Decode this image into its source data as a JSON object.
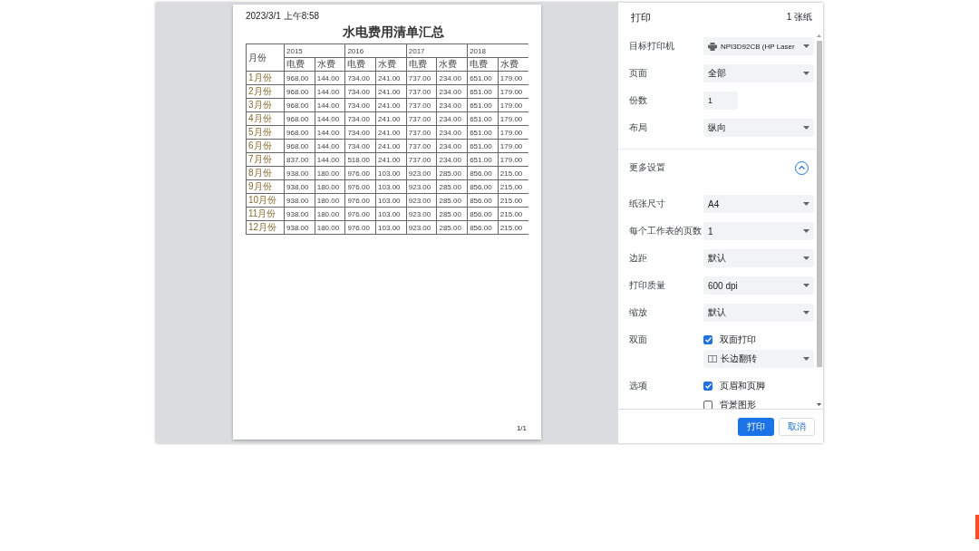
{
  "preview": {
    "timestamp": "2023/3/1 上午8:58",
    "title": "水电费用清单汇总",
    "table": {
      "corner": "月份",
      "years": [
        "2015",
        "2016",
        "2017",
        "2018"
      ],
      "subheaders": [
        "电费",
        "水费",
        "电费",
        "水费",
        "电费",
        "水费",
        "电费",
        "水费"
      ],
      "rows": [
        [
          "1月份",
          "968.00",
          "144.00",
          "734.00",
          "241.00",
          "737.00",
          "234.00",
          "651.00",
          "179.00"
        ],
        [
          "2月份",
          "968.00",
          "144.00",
          "734.00",
          "241.00",
          "737.00",
          "234.00",
          "651.00",
          "179.00"
        ],
        [
          "3月份",
          "968.00",
          "144.00",
          "734.00",
          "241.00",
          "737.00",
          "234.00",
          "651.00",
          "179.00"
        ],
        [
          "4月份",
          "968.00",
          "144.00",
          "734.00",
          "241.00",
          "737.00",
          "234.00",
          "651.00",
          "179.00"
        ],
        [
          "5月份",
          "968.00",
          "144.00",
          "734.00",
          "241.00",
          "737.00",
          "234.00",
          "651.00",
          "179.00"
        ],
        [
          "6月份",
          "968.00",
          "144.00",
          "734.00",
          "241.00",
          "737.00",
          "234.00",
          "651.00",
          "179.00"
        ],
        [
          "7月份",
          "837.00",
          "144.00",
          "518.00",
          "241.00",
          "737.00",
          "234.00",
          "651.00",
          "179.00"
        ],
        [
          "8月份",
          "938.00",
          "180.00",
          "976.00",
          "103.00",
          "923.00",
          "285.00",
          "856.00",
          "215.00"
        ],
        [
          "9月份",
          "938.00",
          "180.00",
          "976.00",
          "103.00",
          "923.00",
          "285.00",
          "856.00",
          "215.00"
        ],
        [
          "10月份",
          "938.00",
          "180.00",
          "976.00",
          "103.00",
          "923.00",
          "285.00",
          "856.00",
          "215.00"
        ],
        [
          "11月份",
          "938.00",
          "180.00",
          "976.00",
          "103.00",
          "923.00",
          "285.00",
          "856.00",
          "215.00"
        ],
        [
          "12月份",
          "938.00",
          "180.00",
          "976.00",
          "103.00",
          "923.00",
          "285.00",
          "856.00",
          "215.00"
        ]
      ]
    },
    "page_number": "1/1"
  },
  "panel": {
    "title": "打印",
    "sheet_count": "1 张纸",
    "rows": [
      {
        "kind": "field",
        "label": "目标打印机",
        "controls": [
          {
            "kind": "select_printer",
            "value": "NPI3D92CB (HP Laser"
          }
        ]
      },
      {
        "kind": "field",
        "label": "页面",
        "controls": [
          {
            "kind": "select",
            "value": "全部"
          }
        ]
      },
      {
        "kind": "field",
        "label": "份数",
        "controls": [
          {
            "kind": "number",
            "value": "1"
          }
        ]
      },
      {
        "kind": "field",
        "label": "布局",
        "controls": [
          {
            "kind": "select",
            "value": "纵向"
          }
        ]
      },
      {
        "kind": "section",
        "label": "更多设置",
        "expanded": true
      },
      {
        "kind": "field",
        "label": "纸张尺寸",
        "controls": [
          {
            "kind": "select",
            "value": "A4"
          }
        ]
      },
      {
        "kind": "field",
        "label": "每个工作表的页数",
        "controls": [
          {
            "kind": "select",
            "value": "1"
          }
        ]
      },
      {
        "kind": "field",
        "label": "边距",
        "controls": [
          {
            "kind": "select",
            "value": "默认"
          }
        ]
      },
      {
        "kind": "field",
        "label": "打印质量",
        "controls": [
          {
            "kind": "select",
            "value": "600 dpi"
          }
        ]
      },
      {
        "kind": "field",
        "label": "缩放",
        "controls": [
          {
            "kind": "select",
            "value": "默认"
          }
        ]
      },
      {
        "kind": "field",
        "label": "双面",
        "controls": [
          {
            "kind": "checkbox",
            "label": "双面打印",
            "checked": true
          },
          {
            "kind": "select_binding",
            "value": "长边翻转"
          }
        ]
      },
      {
        "kind": "field",
        "label": "选项",
        "controls": [
          {
            "kind": "checkbox",
            "label": "页眉和页脚",
            "checked": true
          },
          {
            "kind": "checkbox",
            "label": "背景图形",
            "checked": false
          }
        ]
      }
    ],
    "buttons": [
      {
        "kind": "primary",
        "label": "打印"
      },
      {
        "kind": "secondary",
        "label": "取消"
      }
    ]
  }
}
